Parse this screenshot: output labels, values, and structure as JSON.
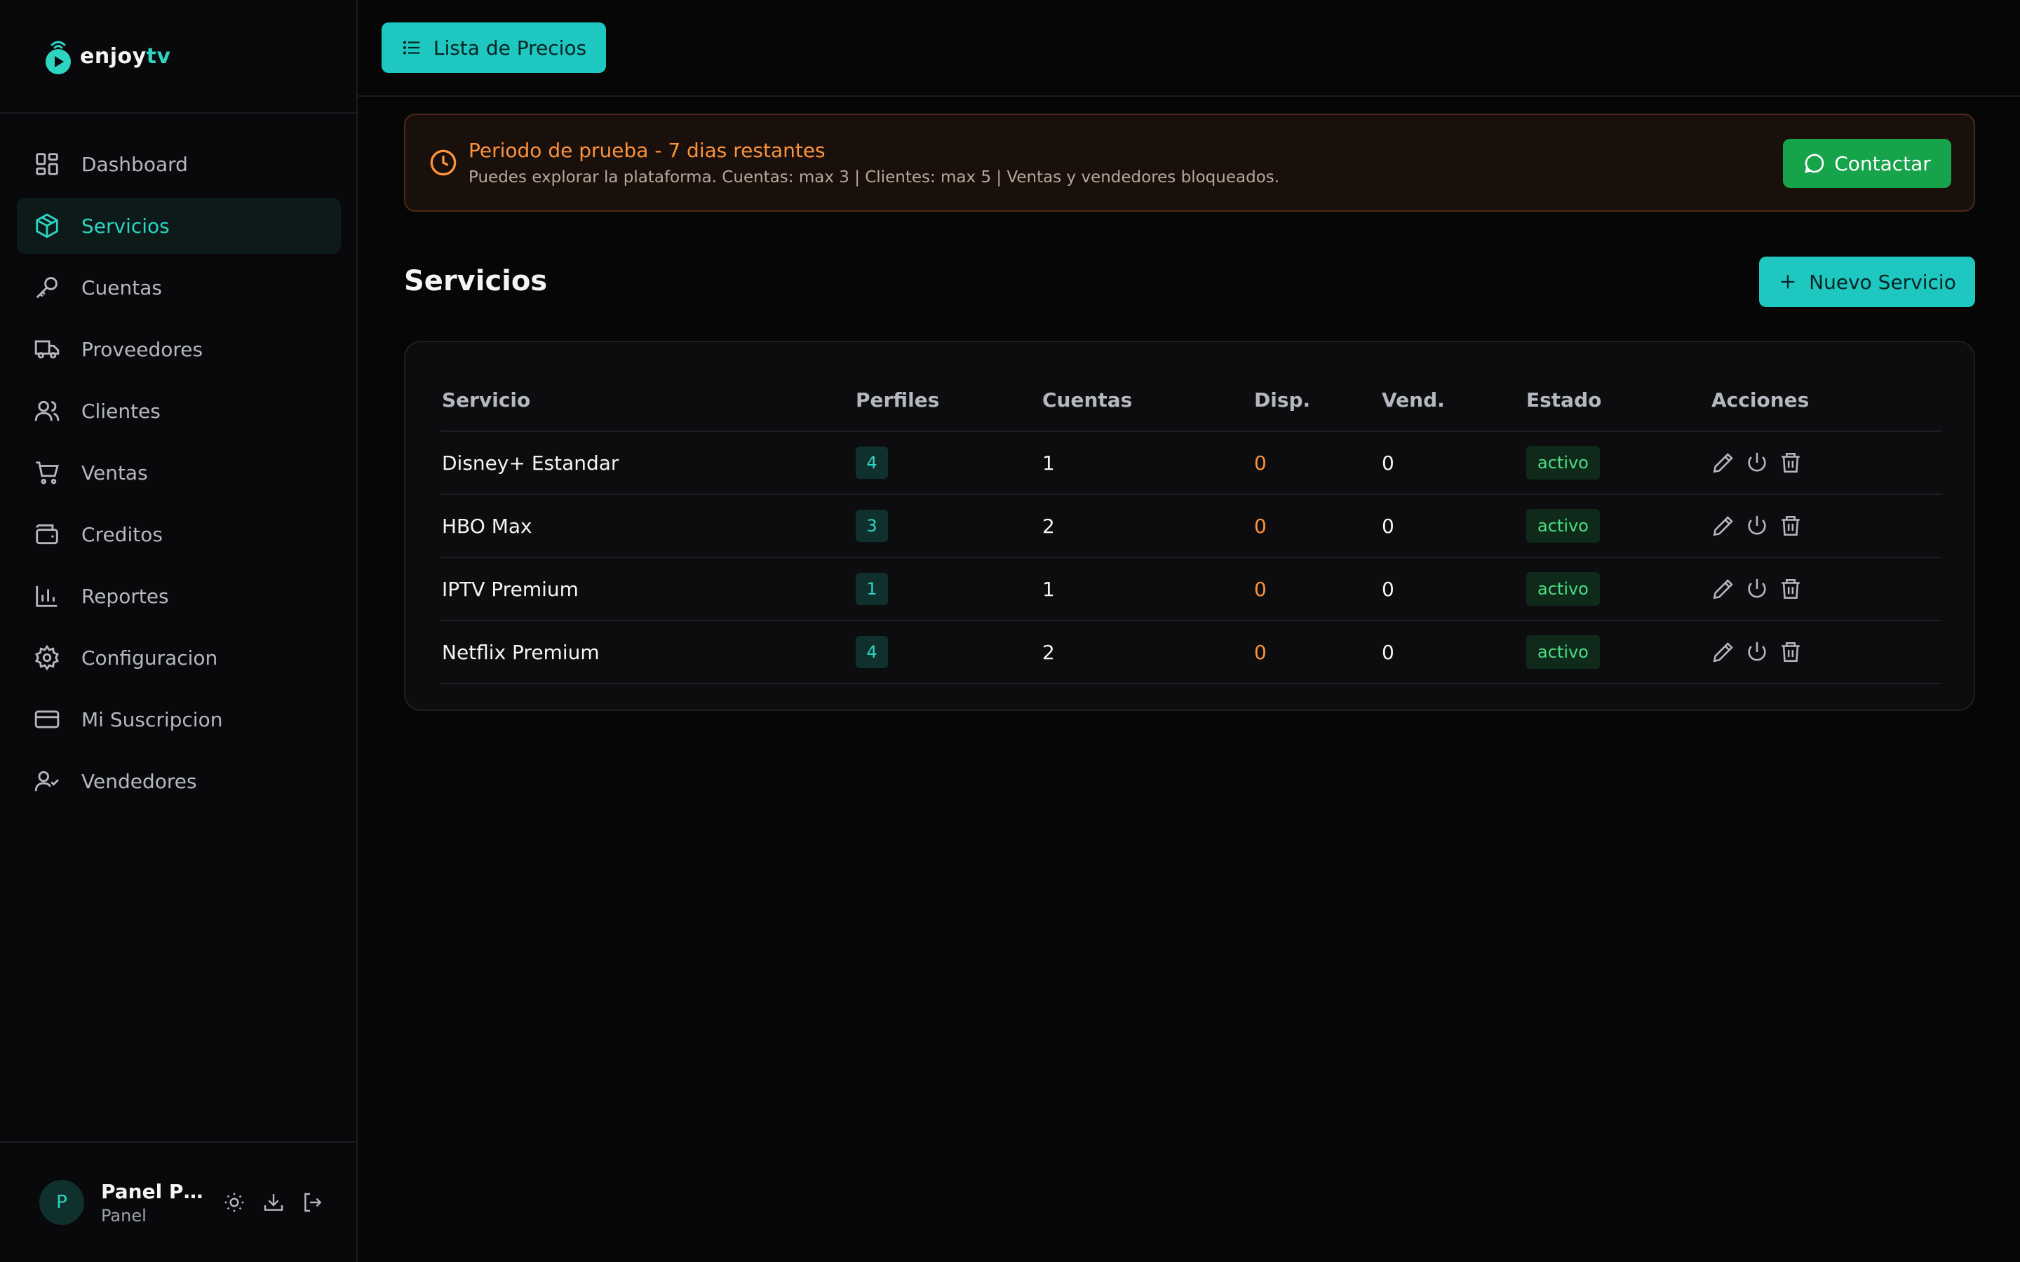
{
  "brand": {
    "name_main": "enjoy",
    "name_accent": "tv"
  },
  "sidebar": {
    "items": [
      {
        "label": "Dashboard",
        "icon": "dashboard-icon"
      },
      {
        "label": "Servicios",
        "icon": "package-icon",
        "active": true
      },
      {
        "label": "Cuentas",
        "icon": "key-icon"
      },
      {
        "label": "Proveedores",
        "icon": "truck-icon"
      },
      {
        "label": "Clientes",
        "icon": "users-icon"
      },
      {
        "label": "Ventas",
        "icon": "cart-icon"
      },
      {
        "label": "Creditos",
        "icon": "wallet-icon"
      },
      {
        "label": "Reportes",
        "icon": "bar-chart-icon"
      },
      {
        "label": "Configuracion",
        "icon": "gear-icon"
      },
      {
        "label": "Mi Suscripcion",
        "icon": "credit-card-icon"
      },
      {
        "label": "Vendedores",
        "icon": "user-check-icon"
      }
    ]
  },
  "user": {
    "initial": "P",
    "name": "Panel Pru...",
    "role": "Panel"
  },
  "topbar": {
    "price_list_label": "Lista de Precios"
  },
  "banner": {
    "title": "Periodo de prueba - 7 dias restantes",
    "subtitle": "Puedes explorar la plataforma. Cuentas: max 3 | Clientes: max 5 | Ventas y vendedores bloqueados.",
    "contact_label": "Contactar"
  },
  "page": {
    "title": "Servicios",
    "new_label": "Nuevo Servicio"
  },
  "table": {
    "headers": [
      "Servicio",
      "Perfiles",
      "Cuentas",
      "Disp.",
      "Vend.",
      "Estado",
      "Acciones"
    ],
    "rows": [
      {
        "servicio": "Disney+ Estandar",
        "perfiles": "4",
        "cuentas": "1",
        "disp": "0",
        "vend": "0",
        "estado": "activo"
      },
      {
        "servicio": "HBO Max",
        "perfiles": "3",
        "cuentas": "2",
        "disp": "0",
        "vend": "0",
        "estado": "activo"
      },
      {
        "servicio": "IPTV Premium",
        "perfiles": "1",
        "cuentas": "1",
        "disp": "0",
        "vend": "0",
        "estado": "activo"
      },
      {
        "servicio": "Netflix Premium",
        "perfiles": "4",
        "cuentas": "2",
        "disp": "0",
        "vend": "0",
        "estado": "activo"
      }
    ]
  },
  "colors": {
    "accent": "#1ec8c0",
    "warning": "#fb923c",
    "success": "#16a34a"
  }
}
